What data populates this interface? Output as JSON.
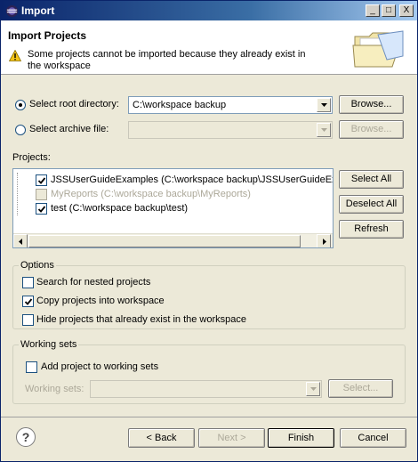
{
  "window": {
    "title": "Import"
  },
  "titlebar_buttons": {
    "minimize": "_",
    "maximize": "□",
    "close": "X"
  },
  "header": {
    "title": "Import Projects",
    "message": "Some projects cannot be imported because they already exist in the workspace"
  },
  "source": {
    "root_directory_label": "Select root directory:",
    "root_directory_value": "C:\\workspace backup",
    "archive_file_label": "Select archive file:",
    "archive_file_value": "",
    "browse_root_label": "Browse...",
    "browse_archive_label": "Browse..."
  },
  "projects": {
    "label": "Projects:",
    "items": [
      {
        "label": "JSSUserGuideExamples (C:\\workspace backup\\JSSUserGuideExam",
        "checked": true,
        "enabled": true
      },
      {
        "label": "MyReports (C:\\workspace backup\\MyReports)",
        "checked": false,
        "enabled": false
      },
      {
        "label": "test (C:\\workspace backup\\test)",
        "checked": true,
        "enabled": true
      }
    ],
    "select_all_label": "Select All",
    "deselect_all_label": "Deselect All",
    "refresh_label": "Refresh"
  },
  "options": {
    "title": "Options",
    "search_nested_label": "Search for nested projects",
    "search_nested_checked": false,
    "copy_projects_label": "Copy projects into workspace",
    "copy_projects_checked": true,
    "hide_existing_label": "Hide projects that already exist in the workspace",
    "hide_existing_checked": false
  },
  "working_sets": {
    "title": "Working sets",
    "add_label": "Add project to working sets",
    "add_checked": false,
    "sets_label": "Working sets:",
    "sets_value": "",
    "select_label": "Select..."
  },
  "footer": {
    "help_label": "?",
    "back_label": "< Back",
    "next_label": "Next >",
    "finish_label": "Finish",
    "cancel_label": "Cancel"
  },
  "colors": {
    "titlebar": "#0a246a",
    "dialog_bg": "#ece9d8",
    "disabled_text": "#aca899"
  }
}
